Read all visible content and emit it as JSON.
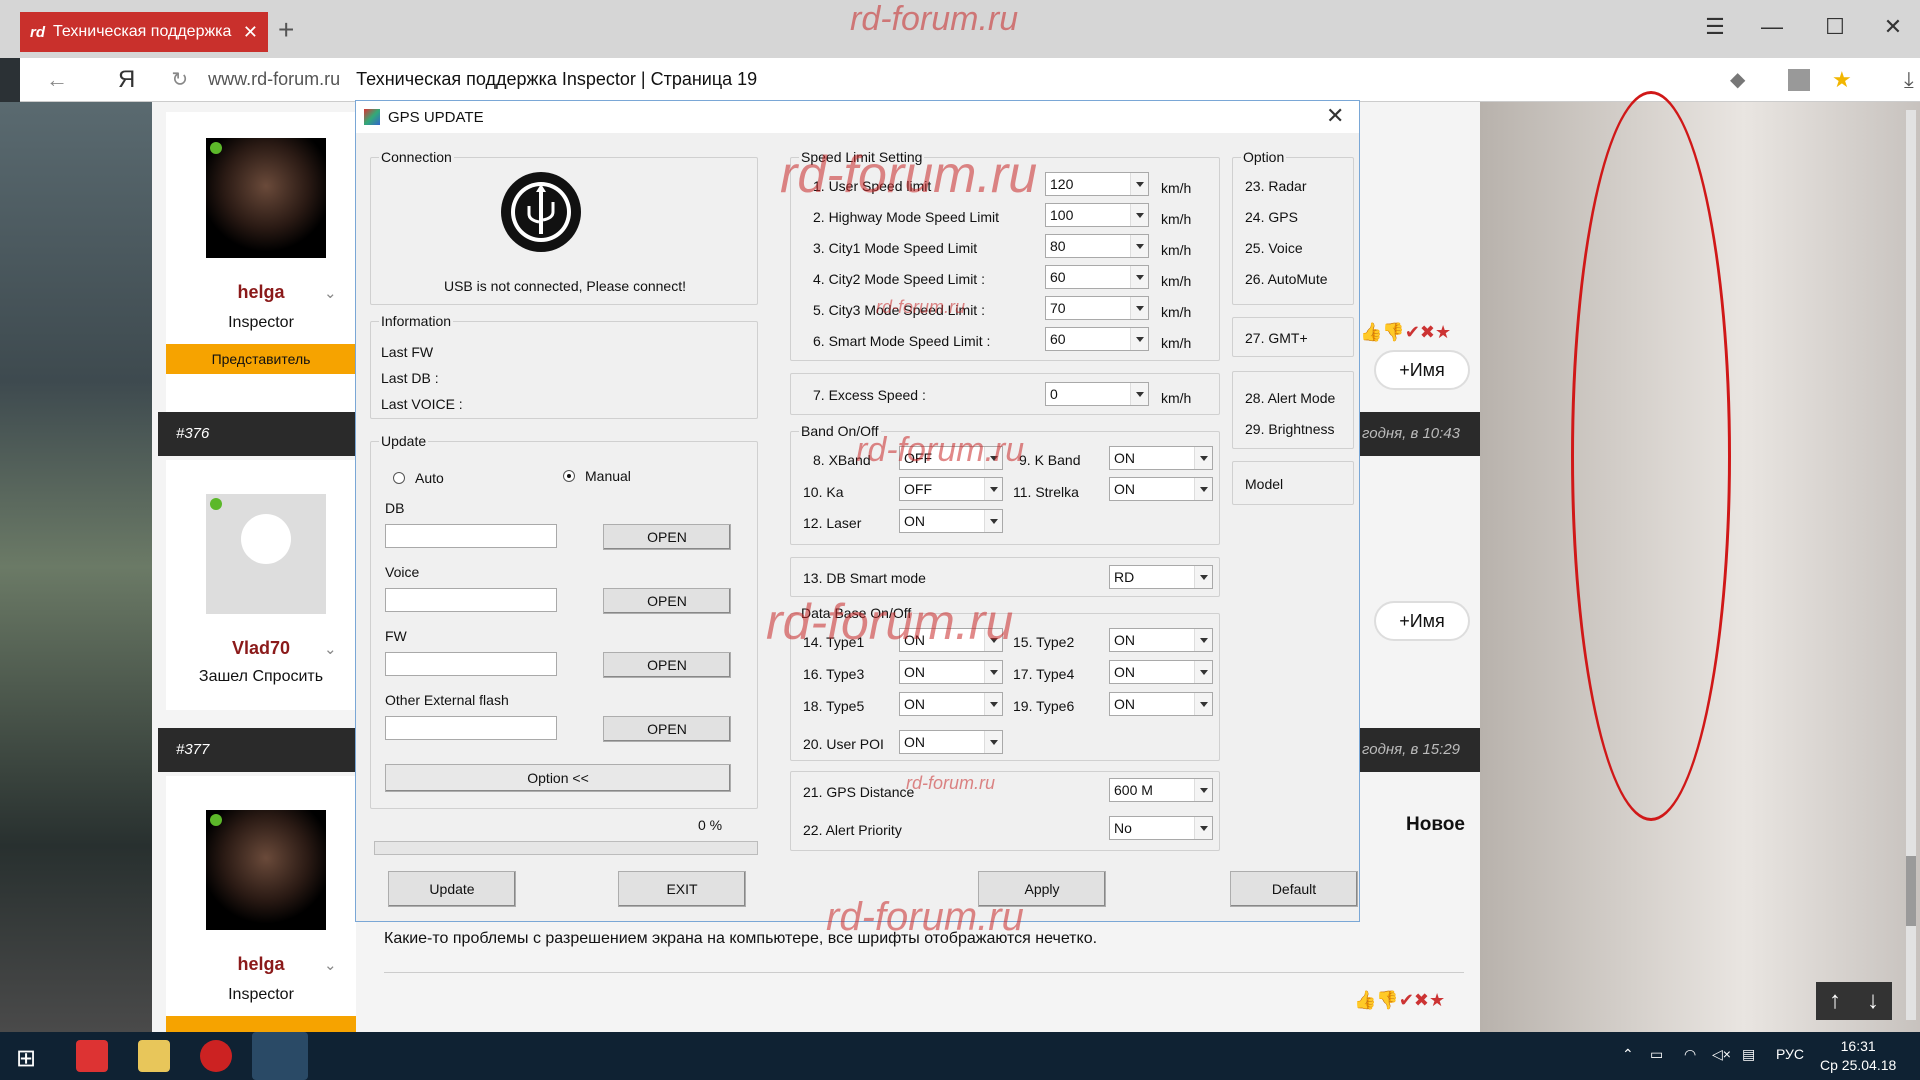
{
  "browser": {
    "tab_title": "Техническая поддержка",
    "tab_logo": "rd",
    "new_tab": "+",
    "url": "www.rd-forum.ru",
    "page_title": "Техническая поддержка Inspector | Страница 19",
    "ya": "Я",
    "menu_icon": "☰",
    "minimize_icon": "—",
    "maximize_icon": "☐",
    "close_icon": "✕"
  },
  "watermark": "rd-forum.ru",
  "forum": {
    "users": [
      {
        "name": "helga",
        "role": "Inspector",
        "rep": "Представитель"
      },
      {
        "name": "Vlad70",
        "role": "Зашел Спросить"
      },
      {
        "name": "helga",
        "role": "Inspector"
      }
    ],
    "posts": [
      {
        "num": "#376",
        "date": "годня, в 10:43"
      },
      {
        "num": "#377",
        "date": "годня, в 15:29"
      }
    ],
    "name_button": "+Имя",
    "new_label": "Новое",
    "post_text": "Какие-то проблемы с разрешением экрана на компьютере, все шрифты отображаются нечетко."
  },
  "dialog": {
    "title": "GPS UPDATE",
    "connection": {
      "title": "Connection",
      "status": "USB is not connected, Please connect!"
    },
    "information": {
      "title": "Information",
      "last_fw": "Last FW",
      "last_db": "Last DB :",
      "last_voice": "Last VOICE :"
    },
    "update": {
      "title": "Update",
      "auto": "Auto",
      "manual": "Manual",
      "db": "DB",
      "voice": "Voice",
      "fw": "FW",
      "other": "Other External flash",
      "open": "OPEN",
      "option_btn": "Option <<"
    },
    "progress": "0 %",
    "buttons": {
      "update": "Update",
      "exit": "EXIT",
      "apply": "Apply",
      "default": "Default"
    },
    "speed": {
      "title": "Speed Limit Setting",
      "unit": "km/h",
      "rows": [
        {
          "label": "1. User Speed limit",
          "value": "120"
        },
        {
          "label": "2. Highway Mode Speed Limit",
          "value": "100"
        },
        {
          "label": "3. City1 Mode Speed Limit",
          "value": "80"
        },
        {
          "label": "4. City2 Mode Speed Limit :",
          "value": "60"
        },
        {
          "label": "5. City3 Mode Speed Limit :",
          "value": "70"
        },
        {
          "label": "6. Smart Mode Speed Limit :",
          "value": "60"
        }
      ],
      "excess_label": "7. Excess Speed :",
      "excess_value": "0"
    },
    "band": {
      "title": "Band On/Off",
      "xband": "8. XBand",
      "xband_v": "OFF",
      "kband": "9. K Band",
      "kband_v": "ON",
      "ka": "10. Ka",
      "ka_v": "OFF",
      "strelka": "11. Strelka",
      "strelka_v": "ON",
      "laser": "12. Laser",
      "laser_v": "ON"
    },
    "dbsmart": {
      "label": "13. DB Smart mode",
      "value": "RD"
    },
    "database": {
      "title": "Data Base On/Off",
      "t1": "14. Type1",
      "t1v": "ON",
      "t2": "15. Type2",
      "t2v": "ON",
      "t3": "16. Type3",
      "t3v": "ON",
      "t4": "17. Type4",
      "t4v": "ON",
      "t5": "18. Type5",
      "t5v": "ON",
      "t6": "19. Type6",
      "t6v": "ON",
      "poi": "20. User POI",
      "poiv": "ON"
    },
    "gps_distance": {
      "label": "21. GPS Distance",
      "value": "600 M"
    },
    "alert_priority": {
      "label": "22. Alert Priority",
      "value": "No"
    },
    "option": {
      "title": "Option",
      "radar": "23. Radar",
      "gps": "24. GPS",
      "voice": "25. Voice",
      "automute": "26. AutoMute",
      "gmt": "27. GMT+",
      "alert_mode": "28. Alert Mode",
      "brightness": "29. Brightness",
      "model": "Model"
    }
  },
  "taskbar": {
    "lang": "РУС",
    "time": "16:31",
    "date": "Ср 25.04.18"
  }
}
